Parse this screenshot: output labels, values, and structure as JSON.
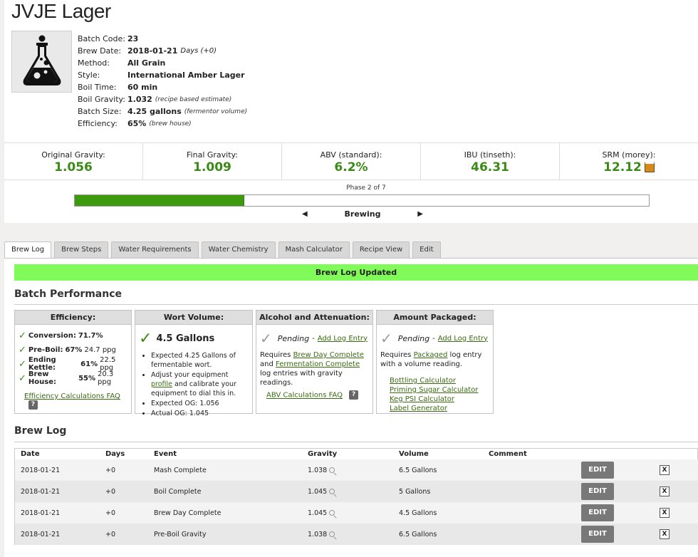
{
  "batch": {
    "title": "JVJE Lager",
    "details": [
      {
        "label": "Batch Code:",
        "value": "23",
        "note": ""
      },
      {
        "label": "Brew Date:",
        "value": "2018-01-21",
        "note": "Days (+0)"
      },
      {
        "label": "Method:",
        "value": "All Grain",
        "note": ""
      },
      {
        "label": "Style:",
        "value": "International Amber Lager",
        "note": ""
      },
      {
        "label": "Boil Time:",
        "value": "60 min",
        "note": ""
      },
      {
        "label": "Boil Gravity:",
        "value": "1.032",
        "note": "(recipe based estimate)"
      },
      {
        "label": "Batch Size:",
        "value": "4.25 gallons",
        "note": "(fermentor volume)"
      },
      {
        "label": "Efficiency:",
        "value": "65%",
        "note": "(brew house)"
      }
    ]
  },
  "stats": [
    {
      "label": "Original Gravity:",
      "value": "1.056"
    },
    {
      "label": "Final Gravity:",
      "value": "1.009"
    },
    {
      "label": "ABV (standard):",
      "value": "6.2%"
    },
    {
      "label": "IBU (tinseth):",
      "value": "46.31"
    },
    {
      "label": "SRM (morey):",
      "value": "12.12"
    }
  ],
  "phase": {
    "label": "Phase 2 of 7",
    "name": "Brewing",
    "progress_fraction": 0.295
  },
  "tabs": [
    "Brew Log",
    "Brew Steps",
    "Water Requirements",
    "Water Chemistry",
    "Mash Calculator",
    "Recipe View",
    "Edit"
  ],
  "banner": "Brew Log Updated",
  "performance": {
    "title": "Batch Performance",
    "efficiency": {
      "title": "Efficiency:",
      "rows": [
        {
          "label": "Conversion:",
          "value": "71.7%",
          "ppg": ""
        },
        {
          "label": "Pre-Boil:",
          "value": "67%",
          "ppg": "24.7 ppg"
        },
        {
          "label": "Ending Kettle:",
          "value": "61%",
          "ppg": "22.5 ppg"
        },
        {
          "label": "Brew House:",
          "value": "55%",
          "ppg": "20.3 ppg"
        }
      ],
      "faq": "Efficiency Calculations FAQ"
    },
    "wort": {
      "title": "Wort Volume:",
      "value": "4.5 Gallons",
      "bullet1": "Expected 4.25 Gallons of fermentable wort.",
      "bullet2_pre": "Adjust your equipment ",
      "bullet2_link": "profile",
      "bullet2_post": " and calibrate your equipment to dial this in.",
      "bullet3": "Expected OG: 1.056",
      "bullet4": "Actual OG: 1.045"
    },
    "alcohol": {
      "title": "Alcohol and Attenuation:",
      "pending": "Pending",
      "add": "Add Log Entry",
      "req_pre": "Requires ",
      "req_link1": "Brew Day Complete",
      "req_mid": " and ",
      "req_link2": "Fermentation Complete",
      "req_post": " log entries with gravity readings.",
      "faq": "ABV Calculations FAQ"
    },
    "packaged": {
      "title": "Amount Packaged:",
      "pending": "Pending",
      "add": "Add Log Entry",
      "req_pre": "Requires ",
      "req_link": "Packaged",
      "req_post": " log entry with a volume reading.",
      "links": [
        "Bottling Calculator",
        "Priming Sugar Calculator",
        "Keg PSI Calculator",
        "Label Generator"
      ]
    }
  },
  "log": {
    "title": "Brew Log",
    "headers": {
      "date": "Date",
      "days": "Days",
      "event": "Event",
      "gravity": "Gravity",
      "volume": "Volume",
      "comment": "Comment"
    },
    "edit_label": "EDIT",
    "delete_label": "X",
    "rows": [
      {
        "date": "2018-01-21",
        "days": "+0",
        "event": "Mash Complete",
        "gravity": "1.038",
        "volume": "6.5 Gallons",
        "comment": ""
      },
      {
        "date": "2018-01-21",
        "days": "+0",
        "event": "Boil Complete",
        "gravity": "1.045",
        "volume": "5 Gallons",
        "comment": ""
      },
      {
        "date": "2018-01-21",
        "days": "+0",
        "event": "Brew Day Complete",
        "gravity": "1.045",
        "volume": "4.5 Gallons",
        "comment": ""
      },
      {
        "date": "2018-01-21",
        "days": "+0",
        "event": "Pre-Boil Gravity",
        "gravity": "1.038",
        "volume": "6.5 Gallons",
        "comment": ""
      }
    ]
  }
}
